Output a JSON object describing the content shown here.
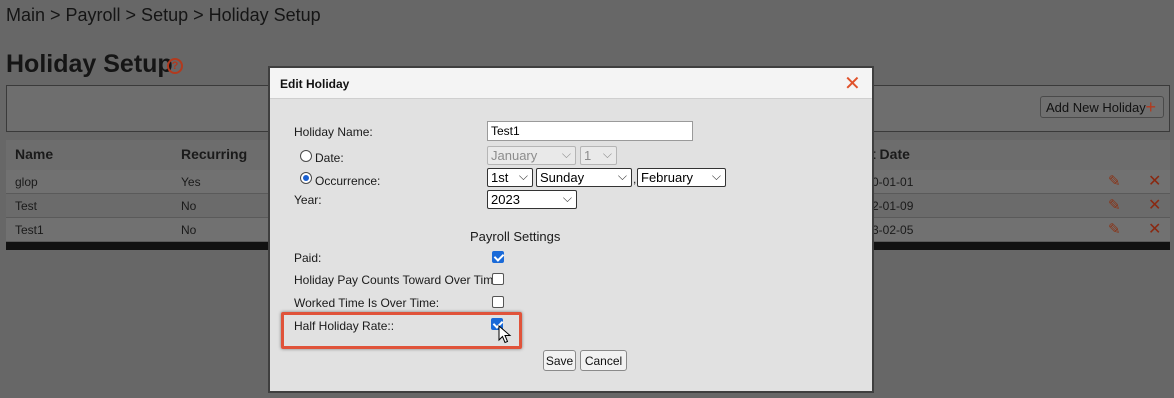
{
  "breadcrumb": "Main > Payroll > Setup > Holiday Setup",
  "page_title": "Holiday Setup",
  "help_icon_glyph": "?",
  "toolbar": {
    "add_label": "Add New Holiday"
  },
  "grid": {
    "columns": [
      "Name",
      "Recurring",
      "t Date"
    ],
    "rows": [
      {
        "name": "glop",
        "recurring": "Yes",
        "date": "0-01-01"
      },
      {
        "name": "Test",
        "recurring": "No",
        "date": "2-01-09"
      },
      {
        "name": "Test1",
        "recurring": "No",
        "date": "3-02-05"
      }
    ]
  },
  "dialog": {
    "title": "Edit Holiday",
    "holiday_name_label": "Holiday Name:",
    "holiday_name_value": "Test1",
    "date_label": "Date:",
    "date_month": "January",
    "date_day": "1",
    "occurrence_label": "Occurrence:",
    "occurrence_ordinal": "1st",
    "occurrence_weekday": "Sunday",
    "occurrence_month": "February",
    "year_label": "Year:",
    "year_value": "2023",
    "payroll_settings_title": "Payroll Settings",
    "paid_label": "Paid:",
    "counts_ot_label": "Holiday Pay Counts Toward Over Time:",
    "worked_ot_label": "Worked Time Is Over Time:",
    "half_rate_label": "Half Holiday Rate::",
    "save_label": "Save",
    "cancel_label": "Cancel",
    "checks": {
      "paid": true,
      "counts_ot": false,
      "worked_ot": false,
      "half_rate": true
    },
    "selected_mode": "occurrence"
  },
  "colors": {
    "accent": "#e0522b",
    "highlight": "#e0533a",
    "check": "#1a6ad8"
  },
  "icons": [
    "help-icon",
    "plus-icon",
    "edit-icon",
    "delete-icon",
    "close-icon",
    "chevron-down-icon",
    "cursor-icon"
  ]
}
